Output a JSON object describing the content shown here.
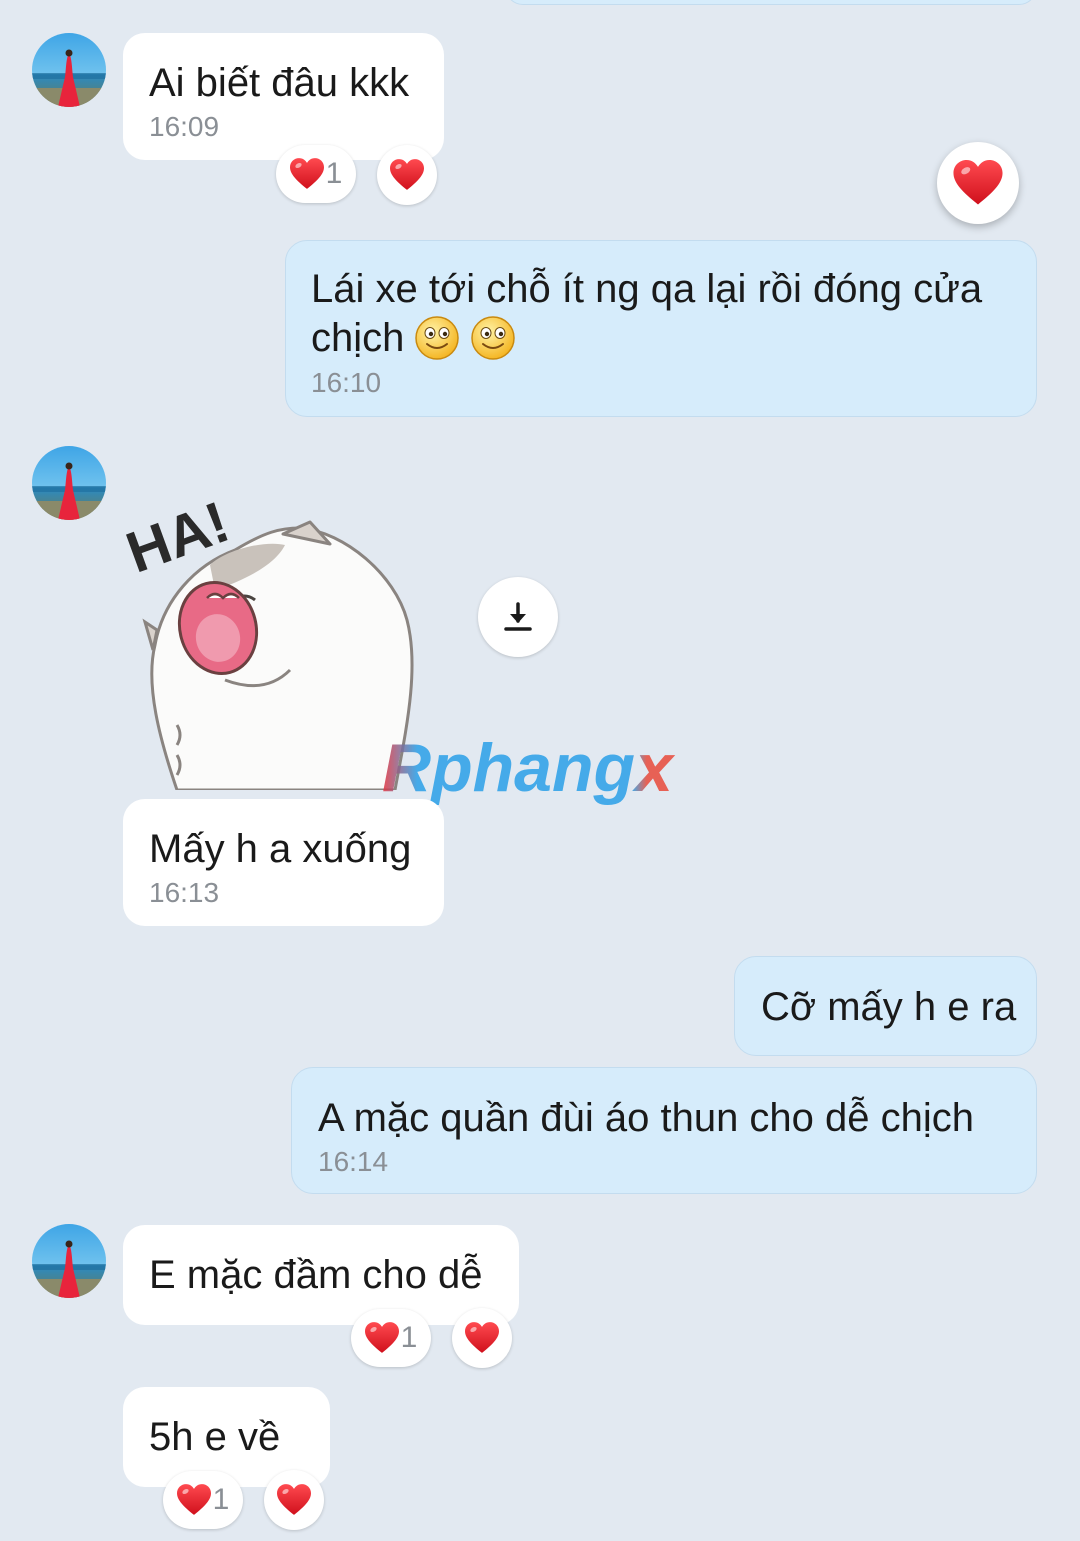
{
  "messages": {
    "m1": {
      "text": "Ai biết đâu kkk",
      "time": "16:09",
      "reaction_count": "1"
    },
    "m2": {
      "text_line1": "Lái xe tới chỗ ít ng qa lại rồi đóng cửa",
      "text_line2": "chịch",
      "time": "16:10"
    },
    "sticker": {
      "text": "HA!"
    },
    "m3": {
      "text": "Mấy h a xuống",
      "time": "16:13"
    },
    "m4": {
      "text": "Cỡ mấy h e ra"
    },
    "m5": {
      "text": "A mặc quần đùi áo thun cho dễ chịch",
      "time": "16:14"
    },
    "m6": {
      "text": "E mặc đầm cho dễ",
      "reaction_count": "1"
    },
    "m7": {
      "text": "5h e về",
      "reaction_count": "1"
    }
  },
  "watermark": {
    "text": "Rphangx"
  },
  "colors": {
    "background": "#e2e9f1",
    "incoming_bubble": "#ffffff",
    "outgoing_bubble": "#d6ecfb",
    "heart": "#e8202a",
    "timestamp": "#8a8f95"
  },
  "icons": [
    "heart-icon",
    "download-icon",
    "smiley-emoji-icon",
    "avatar"
  ]
}
